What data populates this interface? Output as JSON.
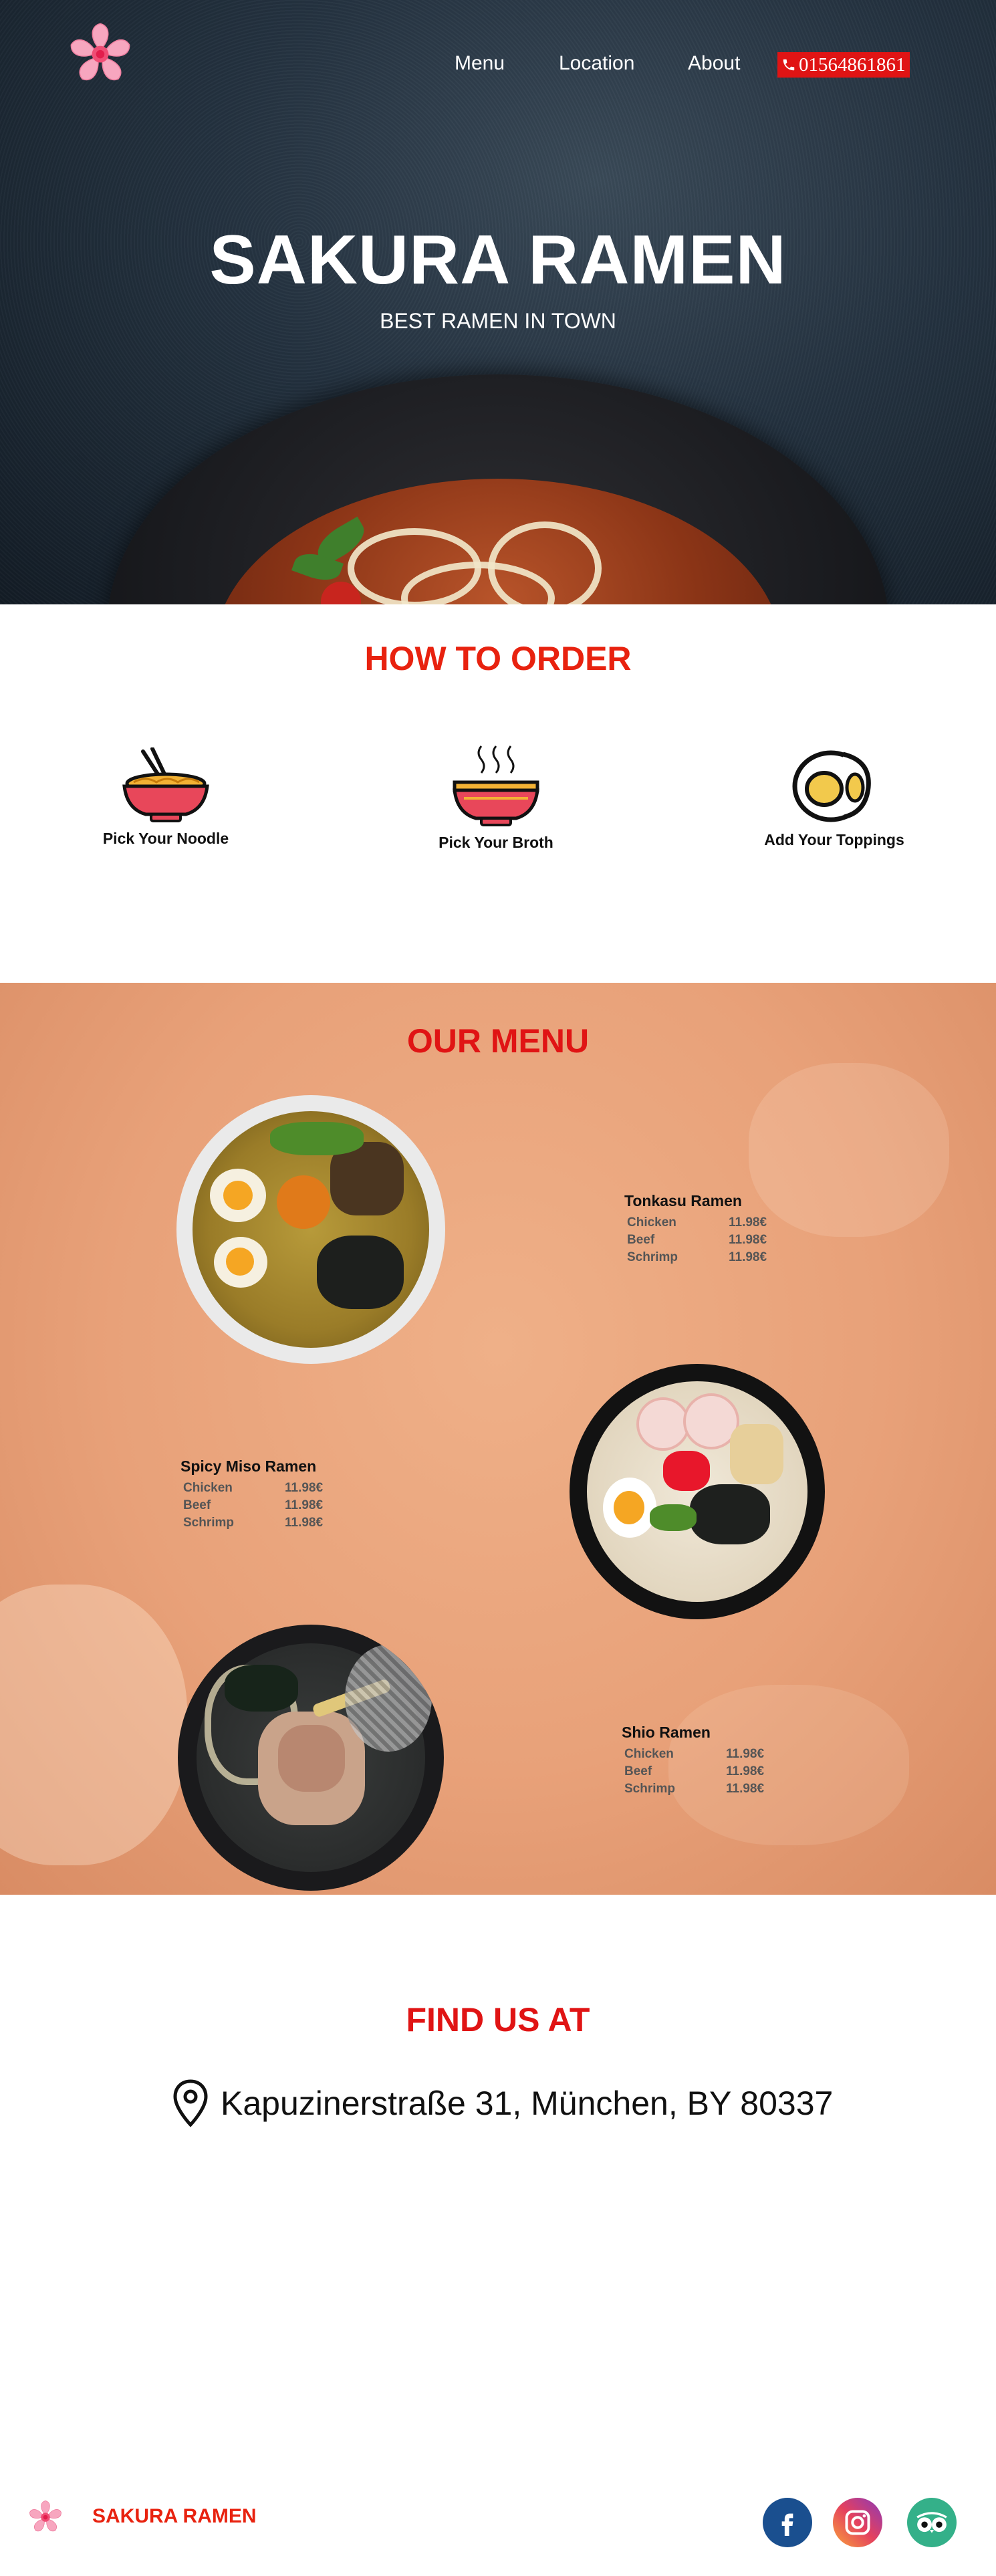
{
  "header": {
    "nav": [
      "Menu",
      "Location",
      "About"
    ],
    "phone": "01564861861",
    "phone_icon": "phone-icon",
    "logo_icon": "sakura-flower-icon"
  },
  "hero": {
    "title": "SAKURA RAMEN",
    "tagline": "BEST RAMEN IN TOWN"
  },
  "how_to_order": {
    "title": "HOW TO ORDER",
    "steps": [
      {
        "label": "Pick Your Noodle",
        "icon": "noodle-bowl-icon"
      },
      {
        "label": "Pick Your Broth",
        "icon": "broth-bowl-icon"
      },
      {
        "label": "Add Your Toppings",
        "icon": "egg-icon"
      }
    ]
  },
  "menu": {
    "title": "OUR MENU",
    "items": [
      {
        "name": "Tonkasu Ramen",
        "options": [
          {
            "label": "Chicken",
            "price": "11.98€"
          },
          {
            "label": "Beef",
            "price": "11.98€"
          },
          {
            "label": "Schrimp",
            "price": "11.98€"
          }
        ]
      },
      {
        "name": "Spicy Miso Ramen",
        "options": [
          {
            "label": "Chicken",
            "price": "11.98€"
          },
          {
            "label": "Beef",
            "price": "11.98€"
          },
          {
            "label": "Schrimp",
            "price": "11.98€"
          }
        ]
      },
      {
        "name": "Shio Ramen",
        "options": [
          {
            "label": "Chicken",
            "price": "11.98€"
          },
          {
            "label": "Beef",
            "price": "11.98€"
          },
          {
            "label": "Schrimp",
            "price": "11.98€"
          }
        ]
      }
    ]
  },
  "find_us": {
    "title": "FIND US AT",
    "address": "Kapuzinerstraße 31, München, BY 80337",
    "icon": "map-pin-icon"
  },
  "footer": {
    "brand": "SAKURA RAMEN",
    "social": [
      "facebook-icon",
      "instagram-icon",
      "tripadvisor-icon"
    ]
  },
  "colors": {
    "accent": "#e8220f",
    "facebook": "#1a4f8f",
    "tripadvisor": "#34b089"
  }
}
